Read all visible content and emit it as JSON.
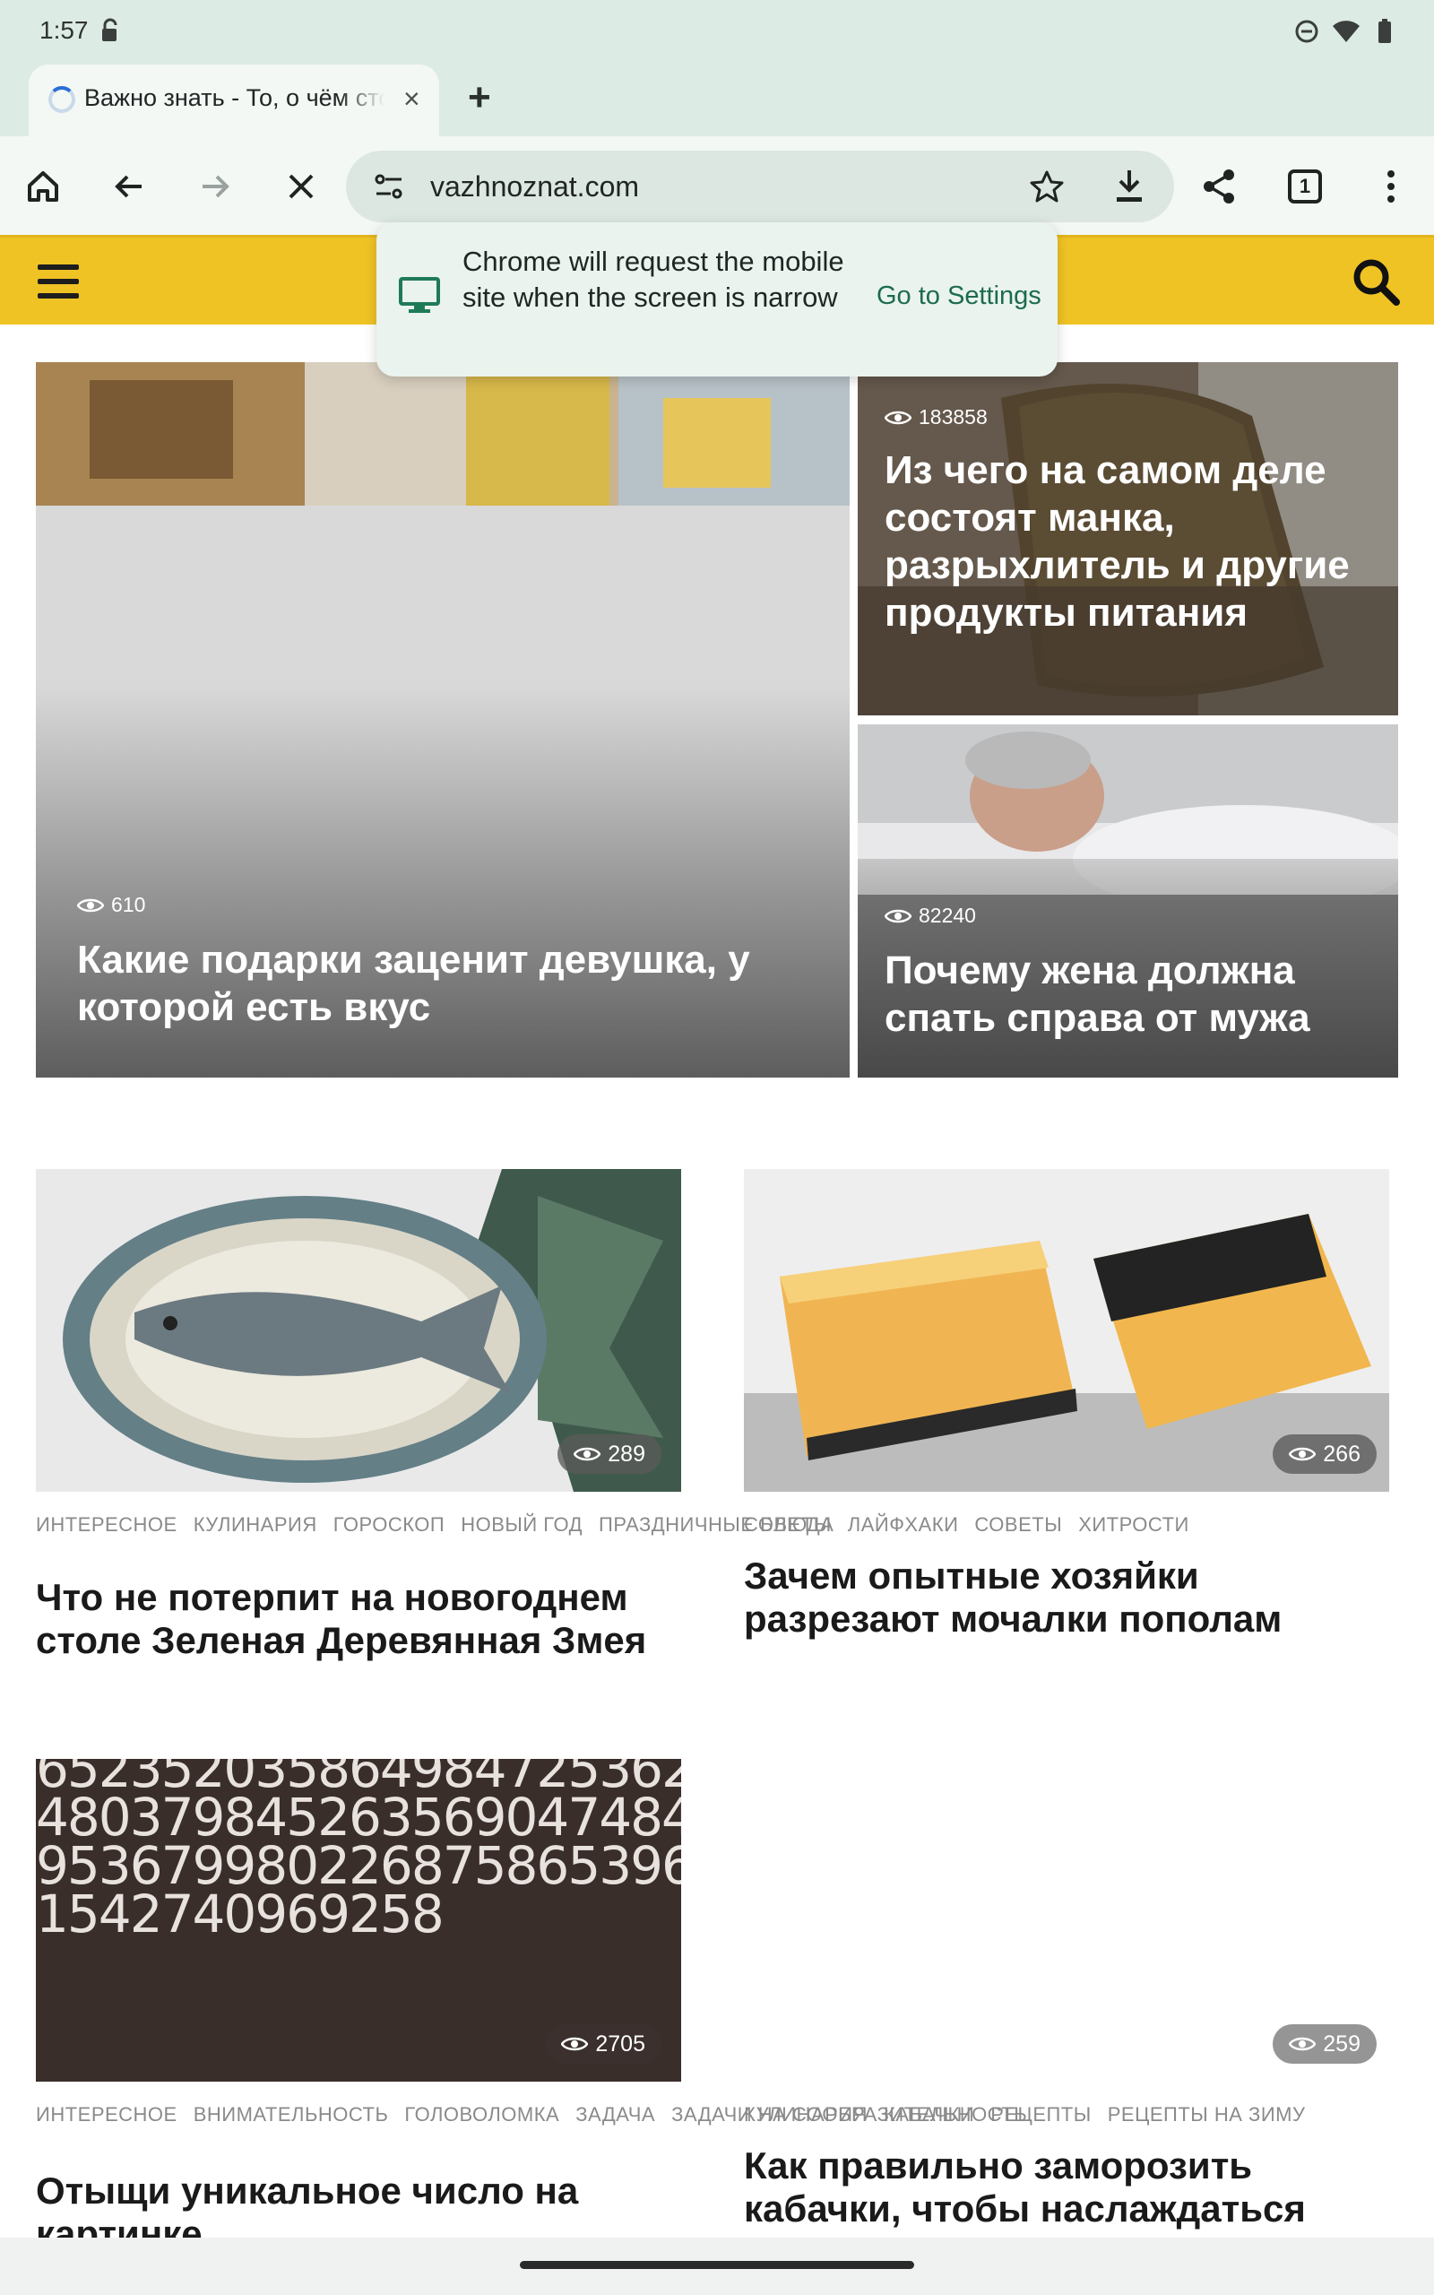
{
  "status_bar": {
    "time": "1:57"
  },
  "tab": {
    "title": "Важно знать - То, о чём стоит знать",
    "close_symbol": "×",
    "new_tab_symbol": "+"
  },
  "toolbar": {
    "url": "vazhnoznat.com",
    "tab_count": "1"
  },
  "popup": {
    "message": "Chrome will request the mobile site when the screen is narrow",
    "action": "Go to Settings"
  },
  "hero": [
    {
      "views": "610",
      "title": "Какие подарки заценит девушка, у которой есть вкус"
    },
    {
      "views": "183858",
      "title": "Из чего на самом деле состоят манка, разрыхлитель и другие продукты питания"
    },
    {
      "views": "82240",
      "title": "Почему жена должна спать справа от мужа"
    }
  ],
  "posts": [
    {
      "views": "289",
      "tags": [
        "ИНТЕРЕСНОЕ",
        "КУЛИНАРИЯ",
        "ГОРОСКОП",
        "НОВЫЙ ГОД",
        "ПРАЗДНИЧНЫЕ БЛЮДА"
      ],
      "title": "Что не потерпит на новогоднем столе Зеленая Деревянная Змея"
    },
    {
      "views": "266",
      "tags": [
        "СОВЕТЫ",
        "ЛАЙФХАКИ",
        "СОВЕТЫ",
        "ХИТРОСТИ"
      ],
      "title": "Зачем опытные хозяйки разрезают мочалки пополам"
    },
    {
      "views": "2705",
      "tags": [
        "ИНТЕРЕСНОЕ",
        "ВНИМАТЕЛЬНОСТЬ",
        "ГОЛОВОЛОМКА",
        "ЗАДАЧА",
        "ЗАДАЧИ НА СООБРАЗИТЕЛЬНОСТЬ"
      ],
      "title": "Отыщи уникальное число на картинке"
    },
    {
      "views": "259",
      "tags": [
        "КУЛИНАРИЯ",
        "КАБАЧКИ",
        "РЕЦЕПТЫ",
        "РЕЦЕПТЫ НА ЗИМУ"
      ],
      "title": "Как правильно заморозить кабачки, чтобы наслаждаться летним вкусом"
    }
  ],
  "colors": {
    "site_header": "#f0c325",
    "browser_chrome": "#dcebe3",
    "popup_action": "#1c6b4f"
  }
}
